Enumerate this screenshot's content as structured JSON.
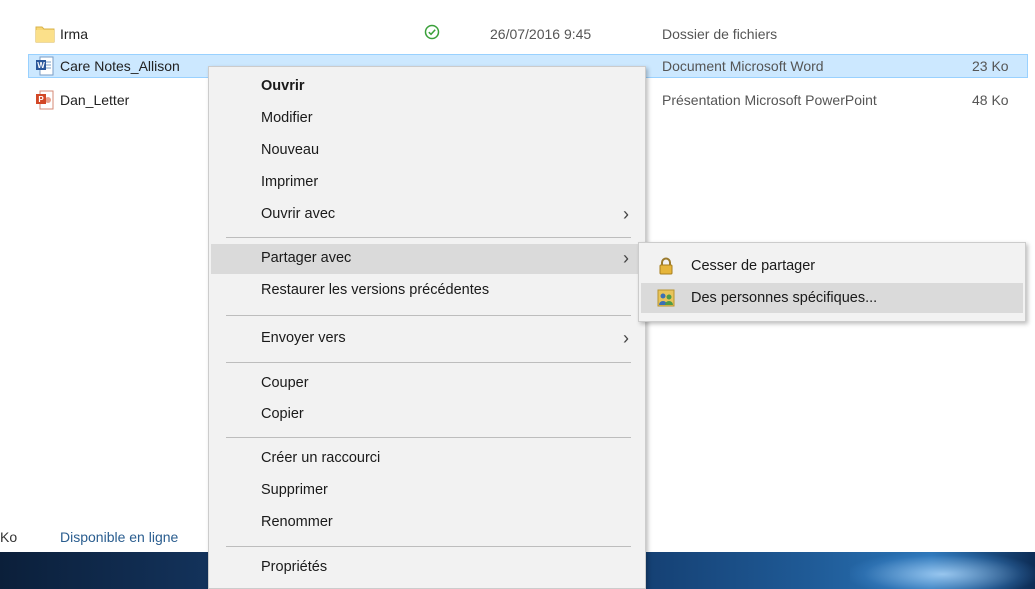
{
  "files": [
    {
      "name": "Irma",
      "status": "available",
      "date": "26/07/2016 9:45",
      "type": "Dossier de fichiers",
      "size": "",
      "icon": "folder-icon"
    },
    {
      "name": "Care Notes_Allison",
      "status": "",
      "date": "",
      "type": "Document Microsoft Word",
      "size": "23 Ko",
      "icon": "word-document-icon",
      "selected": true
    },
    {
      "name": "Dan_Letter",
      "status": "",
      "date": "",
      "type": "Présentation Microsoft PowerPoint",
      "size": "48 Ko",
      "icon": "powerpoint-icon"
    }
  ],
  "statusbar": {
    "size_fragment": "Ko",
    "availability": "Disponible en ligne"
  },
  "context_menu": {
    "open": "Ouvrir",
    "edit": "Modifier",
    "new": "Nouveau",
    "print": "Imprimer",
    "open_with": "Ouvrir avec",
    "share_with": "Partager avec",
    "restore": "Restaurer les versions précédentes",
    "send_to": "Envoyer vers",
    "cut": "Couper",
    "copy": "Copier",
    "create_shortcut": "Créer un raccourci",
    "delete": "Supprimer",
    "rename": "Renommer",
    "properties": "Propriétés",
    "chevron": "›"
  },
  "share_submenu": {
    "stop_sharing": "Cesser de partager",
    "specific_people": "Des personnes spécifiques..."
  },
  "colors": {
    "selection": "#cce8ff",
    "menu_bg": "#f2f2f2",
    "hover": "#dadada",
    "status_ok": "#3aa03a"
  }
}
